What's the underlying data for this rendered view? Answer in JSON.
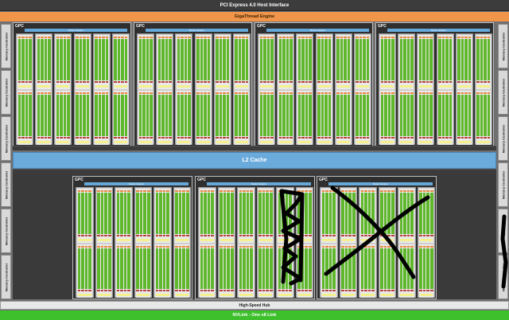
{
  "header": {
    "title": "PCI Express 4.0 Host Interface"
  },
  "giga_thread": {
    "label": "GigaThread Engine"
  },
  "memory_controller_label": "Memory Controller",
  "l2": {
    "label": "L2 Cache"
  },
  "hub": {
    "label": "High-Speed Hub"
  },
  "nvlink": {
    "label": "NVLink - One x8 Link"
  },
  "gpc_label": "GPC",
  "raster_label": "Raster Engine",
  "colors": {
    "pcie": "#3c3c3c",
    "gigathread": "#f0954a",
    "l2": "#6aabdc",
    "nvlink": "#3ec02c",
    "sm_core": "#5fb82c",
    "rt_core": "#f4f08e"
  },
  "upper_gpc_count": 4,
  "lower_gpc_count": 3,
  "scribbles": {
    "gpc_6": "vertical-scrawl",
    "gpc_7": "cross-out"
  }
}
